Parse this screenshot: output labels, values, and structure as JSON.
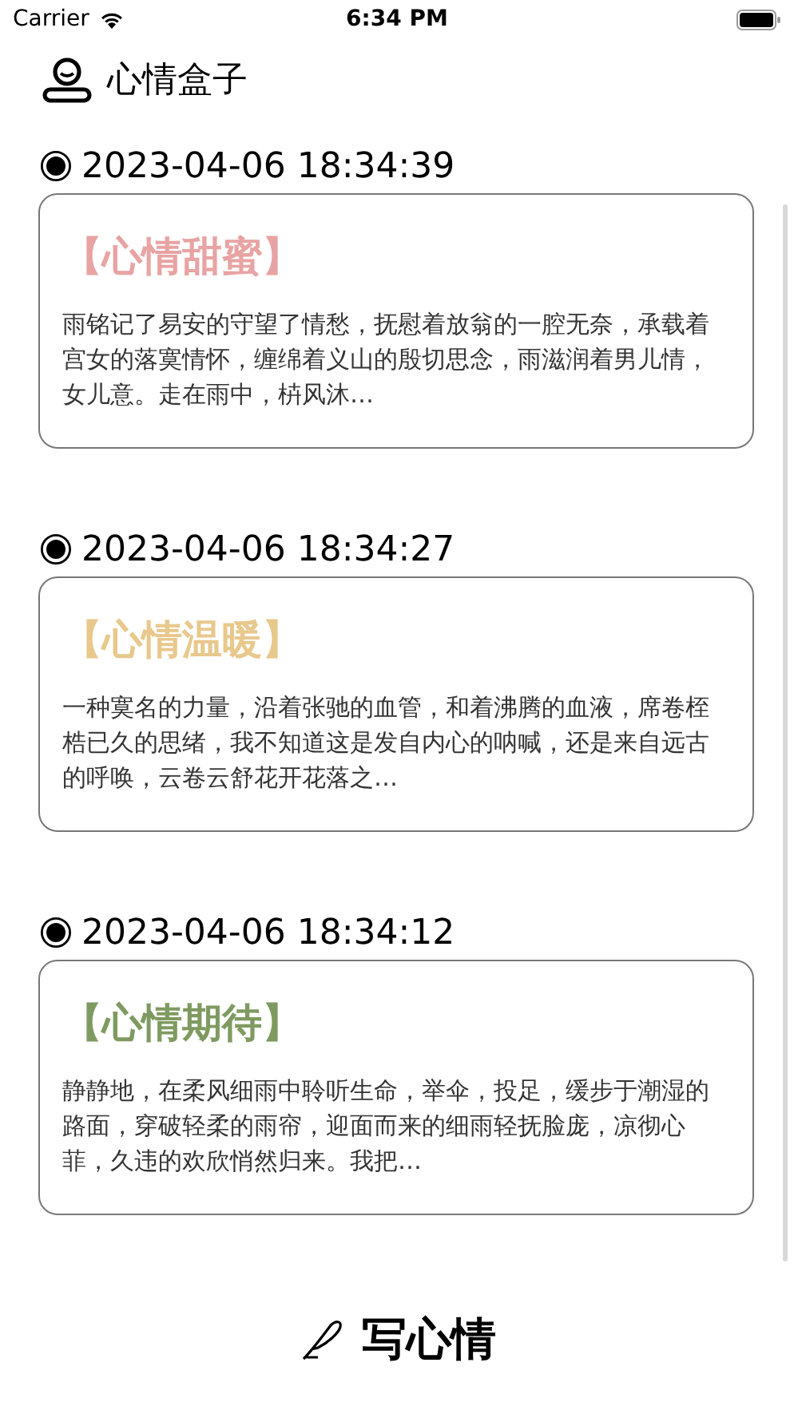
{
  "status_bar": {
    "carrier": "Carrier",
    "time": "6:34 PM"
  },
  "header": {
    "title": "心情盒子"
  },
  "entries": [
    {
      "time": "2023-04-06 18:34:39",
      "mood": "【心情甜蜜】",
      "color": "#e8a3a3",
      "text": "雨铭记了易安的守望了情愁，抚慰着放翁的一腔无奈，承载着宫女的落寞情怀，缠绵着义山的殷切思念，雨滋润着男儿情，女儿意。走在雨中，枿风沐…"
    },
    {
      "time": "2023-04-06 18:34:27",
      "mood": "【心情温暖】",
      "color": "#e8c88c",
      "text": "一种寞名的力量，沿着张驰的血管，和着沸腾的血液，席卷桎梏已久的思绪，我不知道这是发自内心的呐喊，还是来自远古的呼唤，云卷云舒花开花落之…"
    },
    {
      "time": "2023-04-06 18:34:12",
      "mood": "【心情期待】",
      "color": "#7f9a60",
      "text": "静静地，在柔风细雨中聆听生命，举伞，投足，缓步于潮湿的路面，穿破轻柔的雨帘，迎面而来的细雨轻抚脸庞，凉彻心菲，久违的欢欣悄然归来。我把…"
    }
  ],
  "write_button": {
    "label": "写心情"
  }
}
